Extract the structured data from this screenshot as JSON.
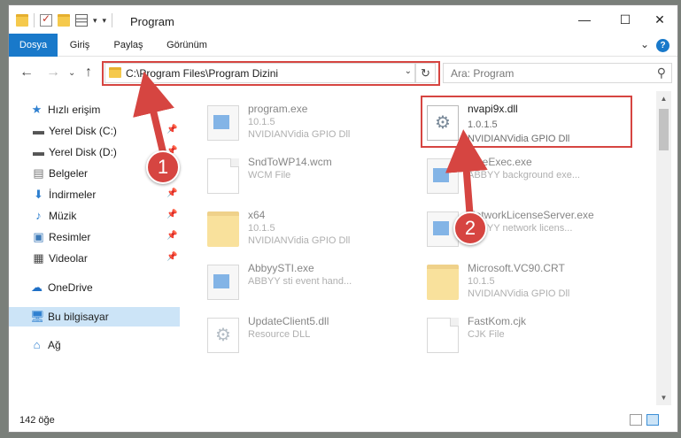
{
  "title": {
    "text": "Program"
  },
  "window_controls": {
    "minimize": "—",
    "maximize": "☐",
    "close": "✕"
  },
  "ribbon": {
    "tabs": [
      {
        "label": "Dosya",
        "active": true
      },
      {
        "label": "Giriş"
      },
      {
        "label": "Paylaş"
      },
      {
        "label": "Görünüm"
      }
    ],
    "help": "?",
    "collapse": "⌄"
  },
  "nav": {
    "back": "←",
    "forward": "→",
    "recent": "⌄",
    "up": "↑",
    "refresh": "↻",
    "dropdown": "⌄"
  },
  "address": {
    "path": "C:\\Program Files\\Program Dizini"
  },
  "search": {
    "placeholder": "Ara: Program",
    "icon": "search-icon"
  },
  "sidebar": {
    "items": [
      {
        "label": "Hızlı erişim",
        "icon": "star-icon"
      },
      {
        "label": "Yerel Disk (C:)",
        "icon": "drive-icon",
        "pinned": true
      },
      {
        "label": "Yerel Disk (D:)",
        "icon": "drive-icon",
        "pinned": true
      },
      {
        "label": "Belgeler",
        "icon": "document-icon",
        "pinned": true
      },
      {
        "label": "İndirmeler",
        "icon": "download-icon",
        "pinned": true
      },
      {
        "label": "Müzik",
        "icon": "music-icon",
        "pinned": true
      },
      {
        "label": "Resimler",
        "icon": "picture-icon",
        "pinned": true
      },
      {
        "label": "Videolar",
        "icon": "video-icon",
        "pinned": true
      },
      {
        "label": "OneDrive",
        "icon": "cloud-icon"
      },
      {
        "label": "Bu bilgisayar",
        "icon": "computer-icon",
        "selected": true
      },
      {
        "label": "Ağ",
        "icon": "network-icon"
      }
    ]
  },
  "files": [
    {
      "name": "program.exe",
      "line1": "10.1.5",
      "line2": "NVIDIANVidia GPIO Dll",
      "icon": "exe-icon"
    },
    {
      "name": "nvapi9x.dll",
      "line1": "1.0.1.5",
      "line2": "NVIDIANVidia GPIO Dll",
      "icon": "dll-icon",
      "highlighted": true
    },
    {
      "name": "SndToWP14.wcm",
      "line1": "WCM File",
      "line2": "",
      "icon": "document-icon"
    },
    {
      "name": "FineExec.exe",
      "line1": "ABBYY background exe...",
      "line2": "",
      "icon": "exe-icon"
    },
    {
      "name": "x64",
      "line1": "10.1.5",
      "line2": "NVIDIANVidia GPIO Dll",
      "icon": "folder-icon"
    },
    {
      "name": "NetworkLicenseServer.exe",
      "line1": "ABBYY network licens...",
      "line2": "",
      "icon": "exe-icon"
    },
    {
      "name": "AbbyySTI.exe",
      "line1": "ABBYY sti event hand...",
      "line2": "",
      "icon": "exe-icon"
    },
    {
      "name": "Microsoft.VC90.CRT",
      "line1": "10.1.5",
      "line2": "NVIDIANVidia GPIO Dll",
      "icon": "folder-icon"
    },
    {
      "name": "UpdateClient5.dll",
      "line1": "Resource DLL",
      "line2": "",
      "icon": "dll-icon"
    },
    {
      "name": "FastKom.cjk",
      "line1": "CJK File",
      "line2": "",
      "icon": "document-icon"
    }
  ],
  "status": {
    "count": "142 öğe"
  },
  "annotations": {
    "step1": "1",
    "step2": "2",
    "color": "#d64541"
  }
}
